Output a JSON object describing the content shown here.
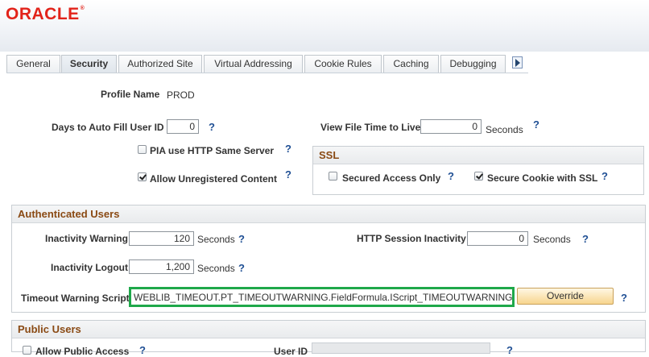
{
  "header": {
    "logo": "ORACLE",
    "logo_mark": "®"
  },
  "tabs": [
    {
      "label": "General"
    },
    {
      "label": "Security"
    },
    {
      "label": "Authorized Site"
    },
    {
      "label": "Virtual Addressing"
    },
    {
      "label": "Cookie Rules"
    },
    {
      "label": "Caching"
    },
    {
      "label": "Debugging"
    }
  ],
  "active_tab": "Security",
  "profile": {
    "label": "Profile Name",
    "value": "PROD"
  },
  "days_auto_fill": {
    "label": "Days to Auto Fill User ID",
    "value": "0"
  },
  "view_file_time": {
    "label": "View File Time to Live",
    "value": "0",
    "unit": "Seconds"
  },
  "pia_http": {
    "label": "PIA use HTTP Same Server",
    "checked": false
  },
  "allow_unregistered": {
    "label": "Allow Unregistered Content",
    "checked": true
  },
  "ssl": {
    "title": "SSL",
    "secured_access": {
      "label": "Secured Access Only",
      "checked": false
    },
    "secure_cookie": {
      "label": "Secure Cookie with SSL",
      "checked": true
    }
  },
  "authenticated_users": {
    "title": "Authenticated Users",
    "inactivity_warning": {
      "label": "Inactivity Warning",
      "value": "120",
      "unit": "Seconds"
    },
    "http_session_inactivity": {
      "label": "HTTP Session Inactivity",
      "value": "0",
      "unit": "Seconds"
    },
    "inactivity_logout": {
      "label": "Inactivity Logout",
      "value": "1,200",
      "unit": "Seconds"
    },
    "timeout_script": {
      "label": "Timeout Warning Script",
      "value": "WEBLIB_TIMEOUT.PT_TIMEOUTWARNING.FieldFormula.IScript_TIMEOUTWARNING",
      "button": "Override"
    }
  },
  "public_users": {
    "title": "Public Users",
    "allow_public_access": {
      "label": "Allow Public Access",
      "checked": false
    },
    "user_id": {
      "label": "User ID"
    }
  },
  "help_glyph": "?",
  "colors": {
    "highlight": "#1fa84a",
    "oracle_red": "#e2231a",
    "section_title": "#8a4a14",
    "help": "#1f4f94"
  }
}
